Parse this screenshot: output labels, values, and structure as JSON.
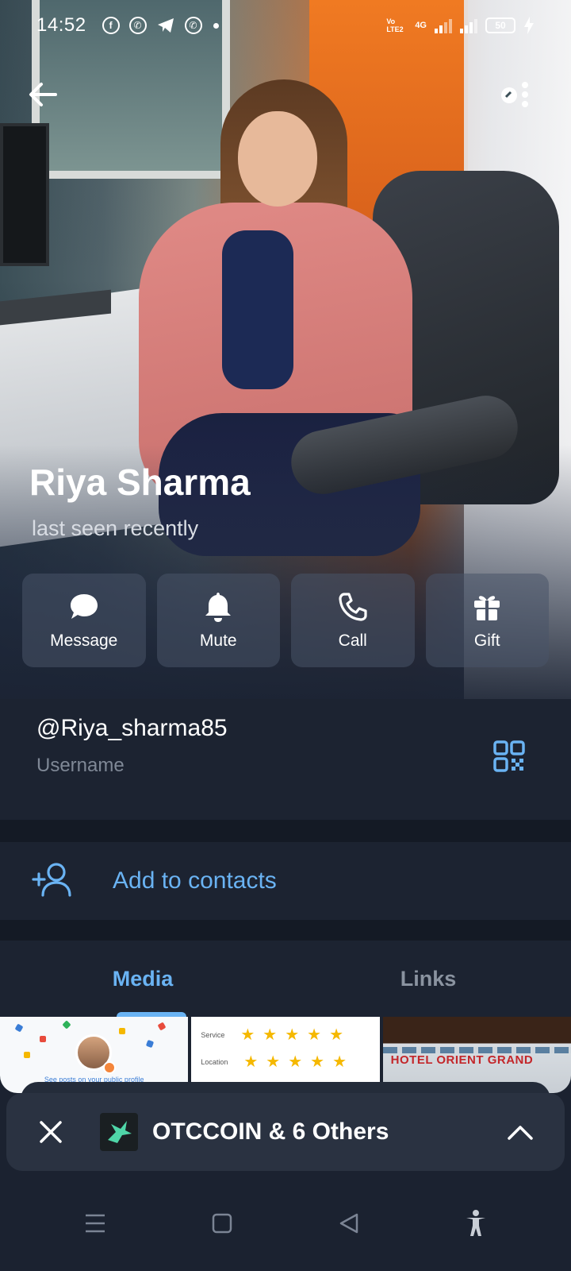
{
  "status_bar": {
    "time": "14:52",
    "network_label": "Vo LTE2",
    "network_type": "4G",
    "battery": "50",
    "left_icons": [
      "facebook-icon",
      "whatsapp-icon",
      "telegram-icon",
      "whatsapp-icon"
    ]
  },
  "profile": {
    "name": "Riya Sharma",
    "status": "last seen recently"
  },
  "actions": [
    {
      "label": "Message",
      "icon": "chat-bubble-icon"
    },
    {
      "label": "Mute",
      "icon": "bell-icon"
    },
    {
      "label": "Call",
      "icon": "phone-icon"
    },
    {
      "label": "Gift",
      "icon": "gift-icon"
    }
  ],
  "username": {
    "value": "@Riya_sharma85",
    "label": "Username"
  },
  "contacts": {
    "add_label": "Add to contacts"
  },
  "tabs": [
    {
      "label": "Media",
      "active": true
    },
    {
      "label": "Links",
      "active": false
    }
  ],
  "media": {
    "item1_caption": "See posts on your public profile",
    "item2_row1": "Service",
    "item2_row2": "Location",
    "item2_stars": "★★★★★",
    "item3_sign": "HOTEL ORIENT GRAND"
  },
  "notification": {
    "title": "OTCCOIN & 6 Others"
  },
  "colors": {
    "accent": "#6ab3f3",
    "background": "#1c2331",
    "separator": "#141a25"
  }
}
